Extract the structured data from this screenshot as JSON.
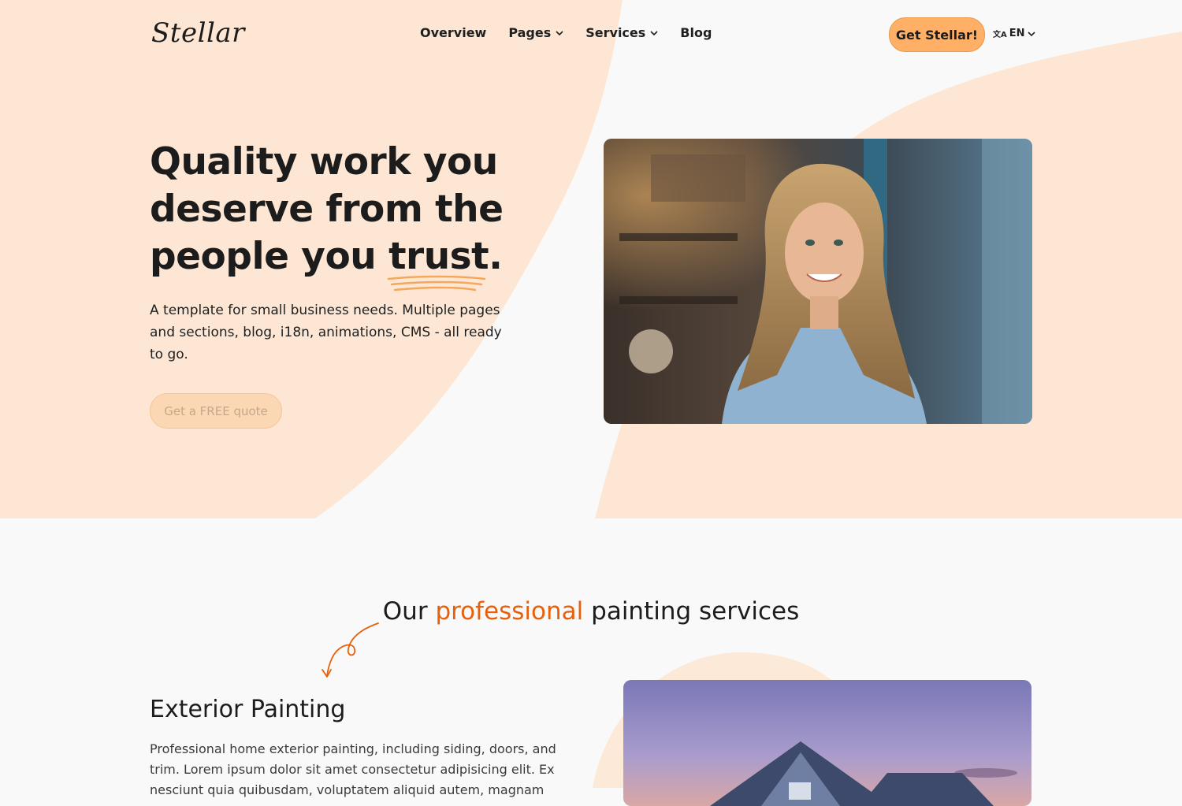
{
  "nav": {
    "logo": "Stellar",
    "links": [
      {
        "label": "Overview",
        "has_dropdown": false
      },
      {
        "label": "Pages",
        "has_dropdown": true
      },
      {
        "label": "Services",
        "has_dropdown": true
      },
      {
        "label": "Blog",
        "has_dropdown": false
      }
    ],
    "cta_label": "Get Stellar!",
    "language": "EN",
    "icons": [
      "translate-icon",
      "chevron-down-icon"
    ]
  },
  "hero": {
    "title_main": "Quality work you deserve from the people you",
    "title_highlight": "trust.",
    "description": "A template for small business needs. Multiple pages and sections, blog, i18n, animations, CMS - all ready to go.",
    "button_label": "Get a FREE quote"
  },
  "services": {
    "title_before": "Our",
    "title_accent": "professional",
    "title_after": "painting services",
    "item_title": "Exterior Painting",
    "item_text": "Professional home exterior painting, including siding, doors, and trim. Lorem ipsum dolor sit amet consectetur adipisicing elit. Ex nesciunt quia quibusdam, voluptatem aliquid autem, magnam"
  },
  "colors": {
    "accent_orange": "#e8600c",
    "button_orange": "#ffb066",
    "peach_bg": "#fde7d4",
    "page_bg": "#f9f9f9"
  }
}
